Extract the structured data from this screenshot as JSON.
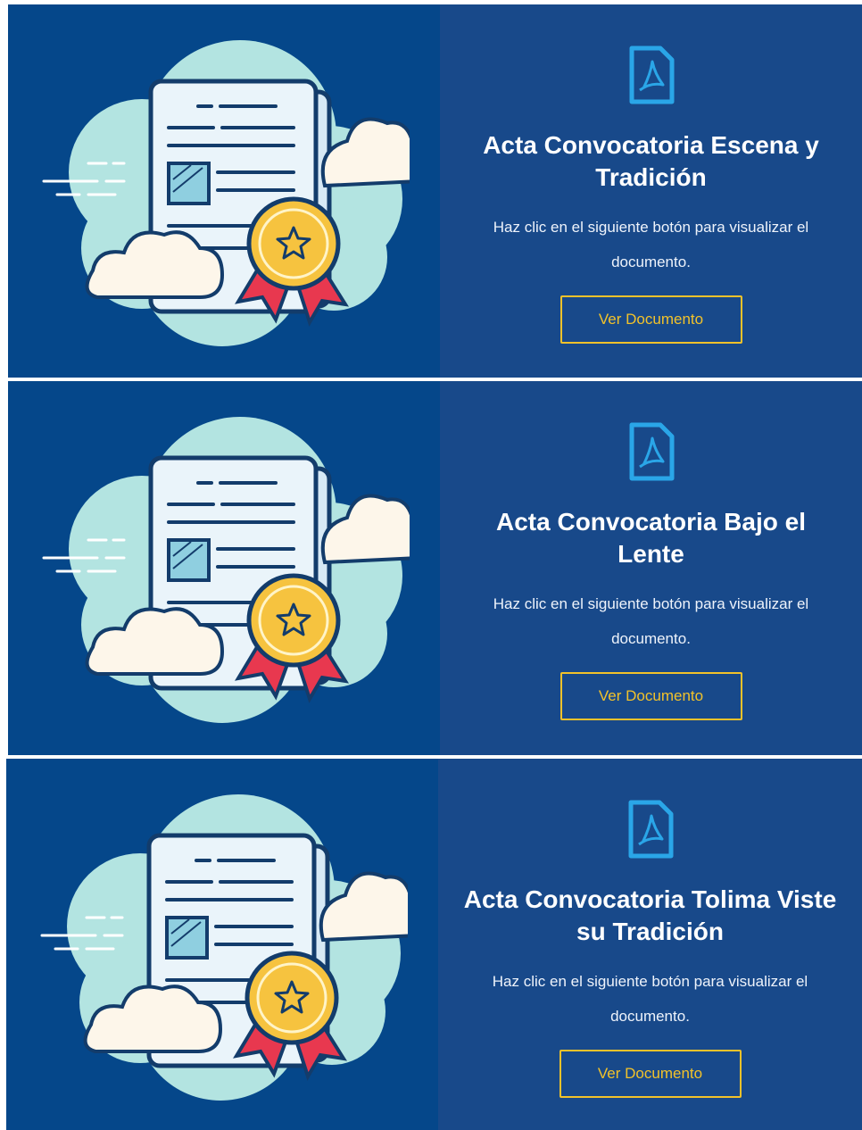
{
  "cards": [
    {
      "title": "Acta Convocatoria Escena y Tradición",
      "description": "Haz clic en el siguiente botón para visualizar el documento.",
      "button_label": "Ver Documento"
    },
    {
      "title": "Acta Convocatoria Bajo el Lente",
      "description": "Haz clic en el siguiente botón para visualizar el documento.",
      "button_label": "Ver Documento"
    },
    {
      "title": "Acta Convocatoria Tolima Viste su Tradición",
      "description": "Haz clic en el siguiente botón para visualizar el documento.",
      "button_label": "Ver Documento"
    }
  ],
  "icons": {
    "document": "pdf-file-icon",
    "illustration": "certificate-document-illustration"
  },
  "colors": {
    "image_panel_bg": "#05478a",
    "text_panel_bg": "#18498a",
    "accent_yellow": "#f2c22a",
    "pdf_icon_blue": "#2aa6e8",
    "cloud_mint": "#b3e4e1",
    "ribbon_red": "#e8384f"
  }
}
